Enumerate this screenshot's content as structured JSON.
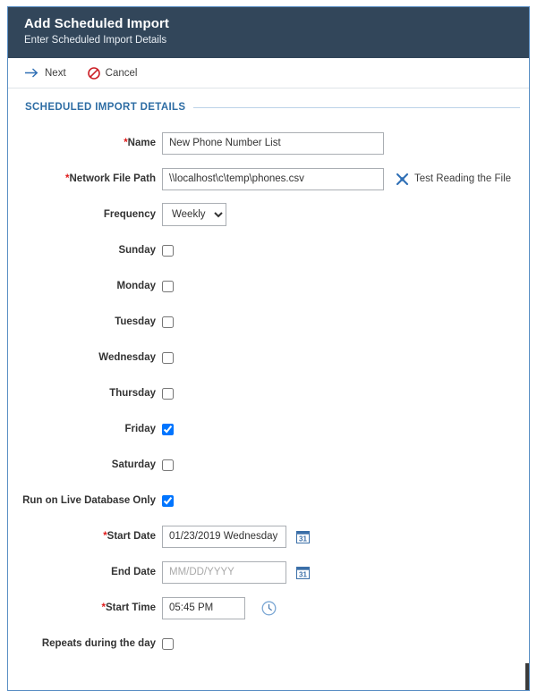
{
  "window": {
    "title": "Add Scheduled Import",
    "subtitle": "Enter Scheduled Import Details",
    "accent_dark": "#32465a",
    "accent_blue": "#2e6da4",
    "border_blue": "#5b8fc4"
  },
  "toolbar": {
    "next_label": "Next",
    "next_icon": "arrow-right-icon",
    "cancel_label": "Cancel",
    "cancel_icon": "no-entry-icon"
  },
  "section": {
    "title": "SCHEDULED IMPORT DETAILS"
  },
  "fields": {
    "name": {
      "label": "Name",
      "required": true,
      "value": "New Phone Number List",
      "placeholder": ""
    },
    "network_file_path": {
      "label": "Network File Path",
      "required": true,
      "value": "\\\\localhost\\c\\temp\\phones.csv",
      "placeholder": "",
      "test_link_label": "Test Reading the File",
      "test_link_icon": "tools-icon"
    },
    "frequency": {
      "label": "Frequency",
      "required": false,
      "value": "Weekly",
      "options": [
        "Weekly"
      ]
    },
    "start_date": {
      "label": "Start Date",
      "required": true,
      "value": "01/23/2019 Wednesday",
      "placeholder": "MM/DD/YYYY",
      "icon": "calendar-icon",
      "icon_day": "31"
    },
    "end_date": {
      "label": "End Date",
      "required": false,
      "value": "",
      "placeholder": "MM/DD/YYYY",
      "icon": "calendar-icon",
      "icon_day": "31"
    },
    "start_time": {
      "label": "Start Time",
      "required": true,
      "value": "05:45 PM",
      "placeholder": "",
      "icon": "clock-icon"
    }
  },
  "checkboxes": [
    {
      "key": "sunday",
      "label": "Sunday",
      "checked": false
    },
    {
      "key": "monday",
      "label": "Monday",
      "checked": false
    },
    {
      "key": "tuesday",
      "label": "Tuesday",
      "checked": false
    },
    {
      "key": "wednesday",
      "label": "Wednesday",
      "checked": false
    },
    {
      "key": "thursday",
      "label": "Thursday",
      "checked": false
    },
    {
      "key": "friday",
      "label": "Friday",
      "checked": true
    },
    {
      "key": "saturday",
      "label": "Saturday",
      "checked": false
    },
    {
      "key": "live_db",
      "label": "Run on Live Database Only",
      "checked": true
    }
  ],
  "repeats": {
    "label": "Repeats during the day",
    "checked": false
  }
}
